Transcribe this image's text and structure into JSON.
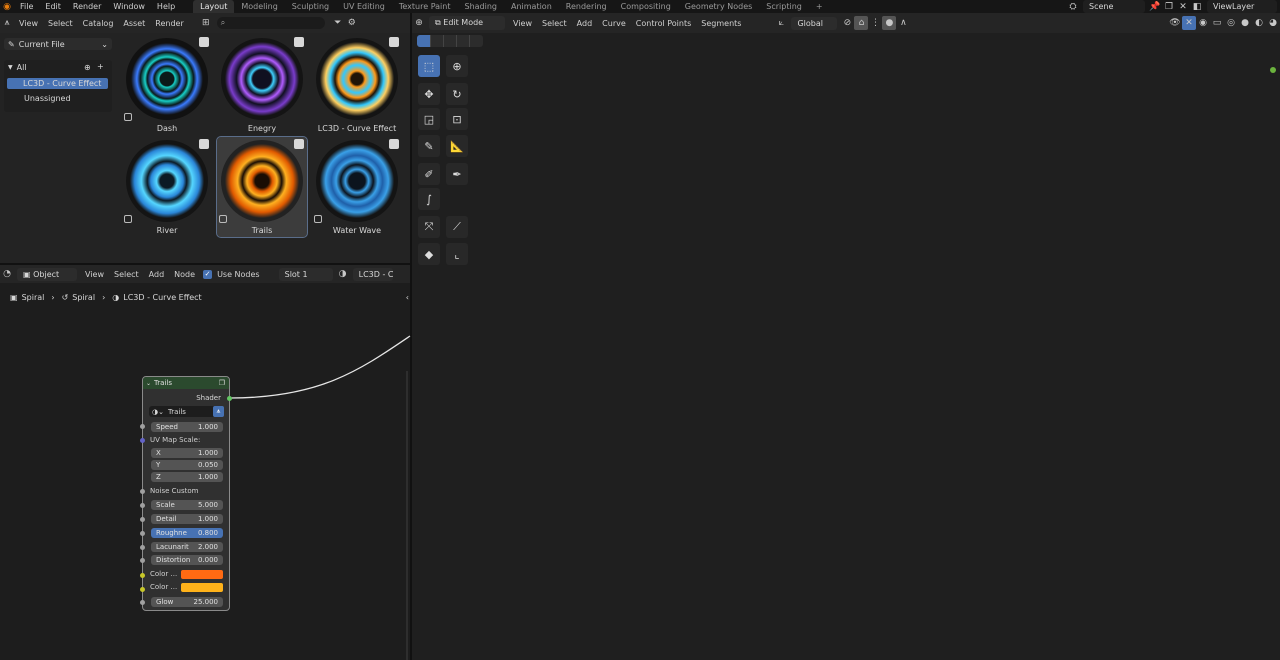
{
  "topbar": {
    "menus": [
      "File",
      "Edit",
      "Render",
      "Window",
      "Help"
    ],
    "workspaces": [
      "Layout",
      "Modeling",
      "Sculpting",
      "UV Editing",
      "Texture Paint",
      "Shading",
      "Animation",
      "Rendering",
      "Compositing",
      "Geometry Nodes",
      "Scripting"
    ],
    "active_workspace": "Layout",
    "add_tab": "+",
    "scene": "Scene",
    "view_layer": "ViewLayer"
  },
  "asset_browser": {
    "menus": [
      "View",
      "Select",
      "Catalog",
      "Asset",
      "Render"
    ],
    "library": "Current File",
    "catalogs": {
      "root": "All",
      "items": [
        "LC3D - Curve Effect",
        "Unassigned"
      ],
      "selected": "LC3D - Curve Effect"
    },
    "assets": [
      {
        "name": "Dash",
        "colors": [
          "#18d0c8",
          "#3a7bff"
        ]
      },
      {
        "name": "Enegry",
        "colors": [
          "#b05cff",
          "#3fd0ff"
        ]
      },
      {
        "name": "LC3D - Curve Effect",
        "colors": [
          "#ff9a1a",
          "#31c8ff"
        ]
      },
      {
        "name": "River",
        "colors": [
          "#55d6ff",
          "#2a86d8"
        ]
      },
      {
        "name": "Trails",
        "colors": [
          "#ffb020",
          "#e05a00"
        ]
      },
      {
        "name": "Water Wave",
        "colors": [
          "#3aa0e8",
          "#1f5fa8"
        ]
      }
    ],
    "selected_asset": "Trails"
  },
  "node_editor": {
    "mode": "Object",
    "menus": [
      "View",
      "Select",
      "Add",
      "Node"
    ],
    "use_nodes": "Use Nodes",
    "slot": "Slot 1",
    "material": "LC3D - C",
    "breadcrumb": [
      "Spiral",
      "Spiral",
      "LC3D - Curve Effect"
    ],
    "node": {
      "title": "Trails",
      "output": "Shader",
      "group_name": "Trails",
      "speed_label": "Speed",
      "speed": "1.000",
      "uv_label": "UV Map Scale:",
      "x_label": "X",
      "x": "1.000",
      "y_label": "Y",
      "y": "0.050",
      "z_label": "Z",
      "z": "1.000",
      "noise_label": "Noise Custom",
      "scale_label": "Scale",
      "scale": "5.000",
      "detail_label": "Detail",
      "detail": "1.000",
      "rough_label": "Roughne",
      "rough": "0.800",
      "lacun_label": "Lacunarit",
      "lacun": "2.000",
      "dist_label": "Distortion",
      "dist": "0.000",
      "color1_label": "Color ...",
      "color1": "#ff6a13",
      "color2_label": "Color ...",
      "color2": "#ffb21a",
      "glow_label": "Glow",
      "glow": "25.000"
    }
  },
  "viewport": {
    "mode": "Edit Mode",
    "menus": [
      "View",
      "Select",
      "Add",
      "Curve",
      "Control Points",
      "Segments"
    ],
    "orientation": "Global"
  }
}
